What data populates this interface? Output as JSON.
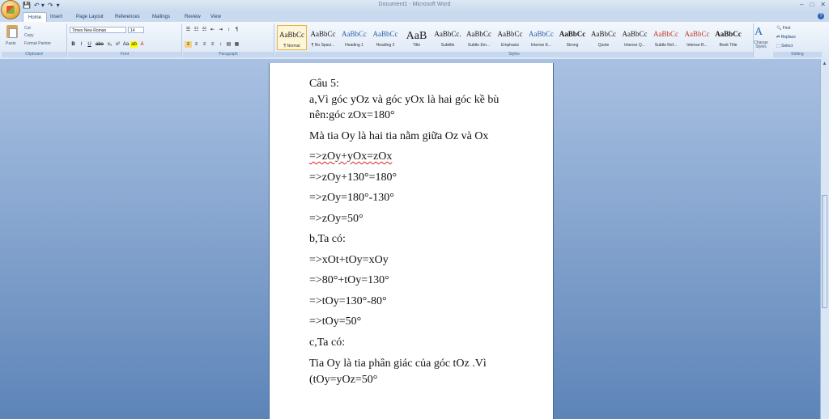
{
  "window": {
    "title": "Document1 - Microsoft Word",
    "controls": [
      "–",
      "□",
      "✕"
    ],
    "qat": [
      "💾",
      "↶ ▾",
      "↷",
      "▾"
    ]
  },
  "tabs": [
    {
      "label": "Home",
      "active": true
    },
    {
      "label": "Insert"
    },
    {
      "label": "Page Layout"
    },
    {
      "label": "References"
    },
    {
      "label": "Mailings"
    },
    {
      "label": "Review"
    },
    {
      "label": "View"
    }
  ],
  "ribbon": {
    "clipboard": {
      "paste": "Paste",
      "cut": "Cut",
      "copy": "Copy",
      "format_painter": "Format Painter",
      "label": "Clipboard"
    },
    "font": {
      "name": "Times New Roman",
      "size": "14",
      "label": "Font",
      "buttons": [
        "B",
        "I",
        "U",
        "abe",
        "x₂",
        "x²",
        "Aa",
        "ab",
        "A"
      ]
    },
    "paragraph": {
      "label": "Paragraph",
      "buttons": [
        "≡",
        "≡",
        "≡",
        "≡",
        "↕",
        "▤",
        "▦"
      ]
    },
    "styles": {
      "label": "Styles",
      "items": [
        {
          "sample": "AaBbCc",
          "name": "¶ Normal",
          "selected": true
        },
        {
          "sample": "AaBbCc",
          "name": "¶ No Spaci..."
        },
        {
          "sample": "AaBbCc",
          "name": "Heading 1"
        },
        {
          "sample": "AaBbCc",
          "name": "Heading 2"
        },
        {
          "sample": "AaB",
          "name": "Title"
        },
        {
          "sample": "AaBbCc.",
          "name": "Subtitle"
        },
        {
          "sample": "AaBbCc",
          "name": "Subtle Em..."
        },
        {
          "sample": "AaBbCc",
          "name": "Emphasis"
        },
        {
          "sample": "AaBbCc",
          "name": "Intense E..."
        },
        {
          "sample": "AaBbCc",
          "name": "Strong"
        },
        {
          "sample": "AaBbCc",
          "name": "Quote"
        },
        {
          "sample": "AaBbCc",
          "name": "Intense Q..."
        },
        {
          "sample": "AaBbCc",
          "name": "Subtle Ref..."
        },
        {
          "sample": "AaBbCc",
          "name": "Intense R..."
        },
        {
          "sample": "AaBbCc",
          "name": "Book Title"
        }
      ],
      "change_styles": "Change Styles"
    },
    "editing": {
      "label": "Editing",
      "find": "Find",
      "replace": "Replace",
      "select": "Select"
    }
  },
  "document": {
    "lines": [
      "Câu 5:",
      "a,Vì góc yOz và góc yOx là hai góc kề bù",
      "nên:góc zOx=180°",
      "Mà tia Oy là hai tia nằm giữa Oz và Ox",
      "=>zOy+yOx=zOx",
      "=>zOy+130°=180°",
      "=>zOy=180°-130°",
      "=>zOy=50°",
      "b,Ta có:",
      "=>xOt+tOy=xOy",
      "=>80°+tOy=130°",
      "=>tOy=130°-80°",
      "=>tOy=50°",
      "c,Ta có:",
      "Tia Oy là tia phân giác của góc tOz .Vì",
      "(tOy=yOz=50°"
    ]
  }
}
